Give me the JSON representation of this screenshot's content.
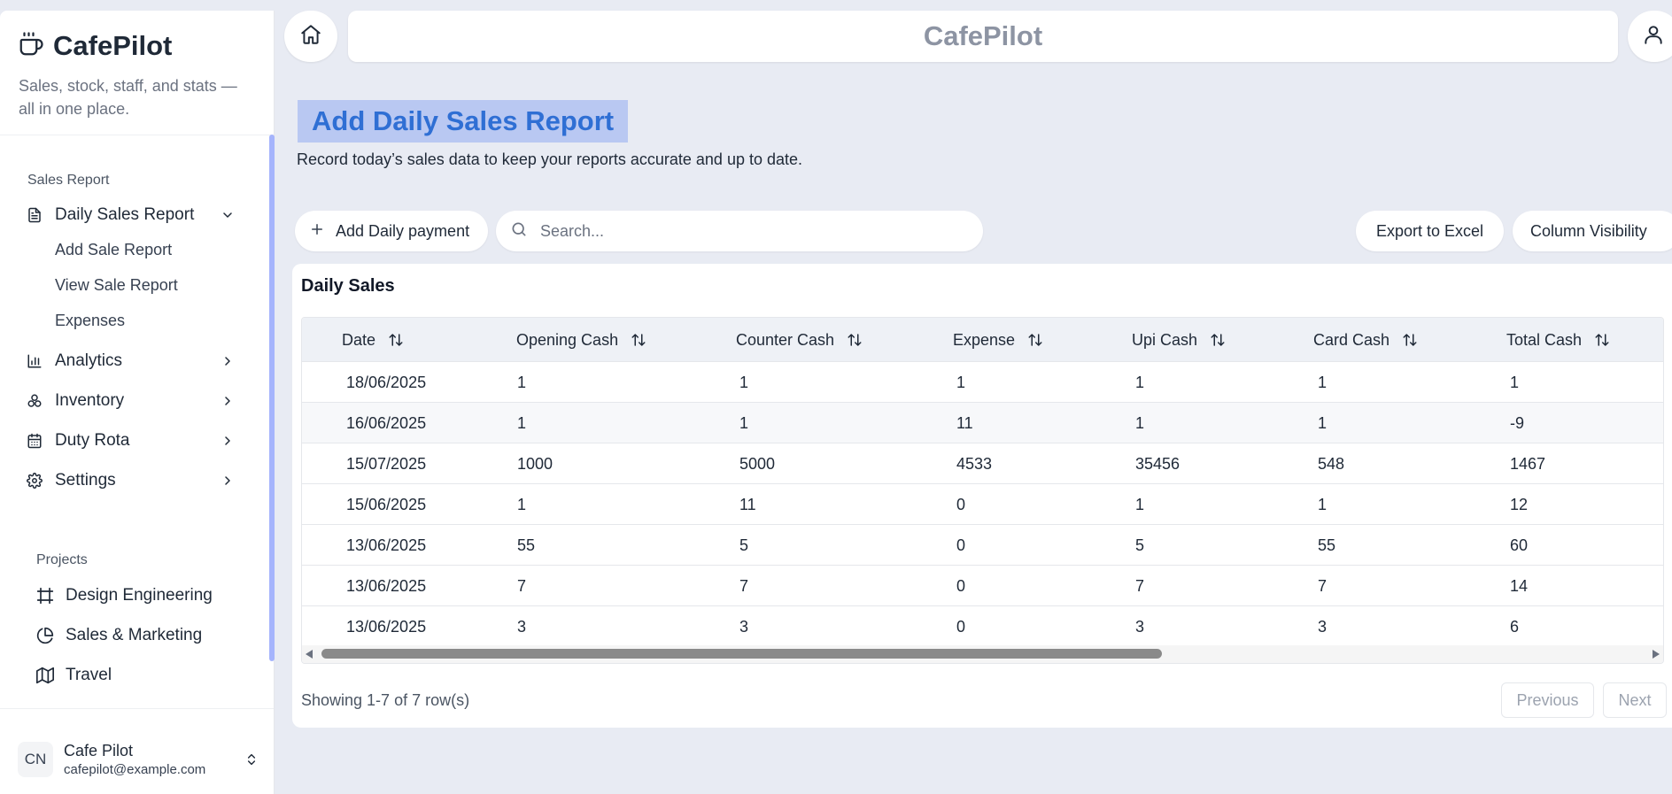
{
  "brand": {
    "name": "CafePilot",
    "tagline": "Sales, stock, staff, and stats — all in one place."
  },
  "sidebar": {
    "group_label": "Sales Report",
    "daily_sales_report": "Daily Sales Report",
    "sub_items": [
      "Add Sale Report",
      "View Sale Report",
      "Expenses"
    ],
    "nav": [
      "Analytics",
      "Inventory",
      "Duty Rota",
      "Settings"
    ],
    "projects_label": "Projects",
    "projects": [
      "Design Engineering",
      "Sales & Marketing",
      "Travel"
    ],
    "user": {
      "initials": "CN",
      "name": "Cafe Pilot",
      "email": "cafepilot@example.com"
    }
  },
  "topbar": {
    "title": "CafePilot"
  },
  "page": {
    "title": "Add Daily Sales Report",
    "subtitle": "Record today’s sales data to keep your reports accurate and up to date."
  },
  "toolbar": {
    "add_label": "Add Daily payment",
    "search_placeholder": "Search...",
    "export_label": "Export to Excel",
    "column_visibility_label": "Column Visibility"
  },
  "table": {
    "title": "Daily Sales",
    "columns": [
      "Date",
      "Opening Cash",
      "Counter Cash",
      "Expense",
      "Upi Cash",
      "Card Cash",
      "Total Cash"
    ],
    "rows": [
      [
        "18/06/2025",
        "1",
        "1",
        "1",
        "1",
        "1",
        "1"
      ],
      [
        "16/06/2025",
        "1",
        "1",
        "11",
        "1",
        "1",
        "-9"
      ],
      [
        "15/07/2025",
        "1000",
        "5000",
        "4533",
        "35456",
        "548",
        "1467"
      ],
      [
        "15/06/2025",
        "1",
        "11",
        "0",
        "1",
        "1",
        "12"
      ],
      [
        "13/06/2025",
        "55",
        "5",
        "0",
        "5",
        "55",
        "60"
      ],
      [
        "13/06/2025",
        "7",
        "7",
        "0",
        "7",
        "7",
        "14"
      ],
      [
        "13/06/2025",
        "3",
        "3",
        "0",
        "3",
        "3",
        "6"
      ]
    ],
    "showing": "Showing 1-7 of 7 row(s)",
    "previous_label": "Previous",
    "next_label": "Next"
  }
}
